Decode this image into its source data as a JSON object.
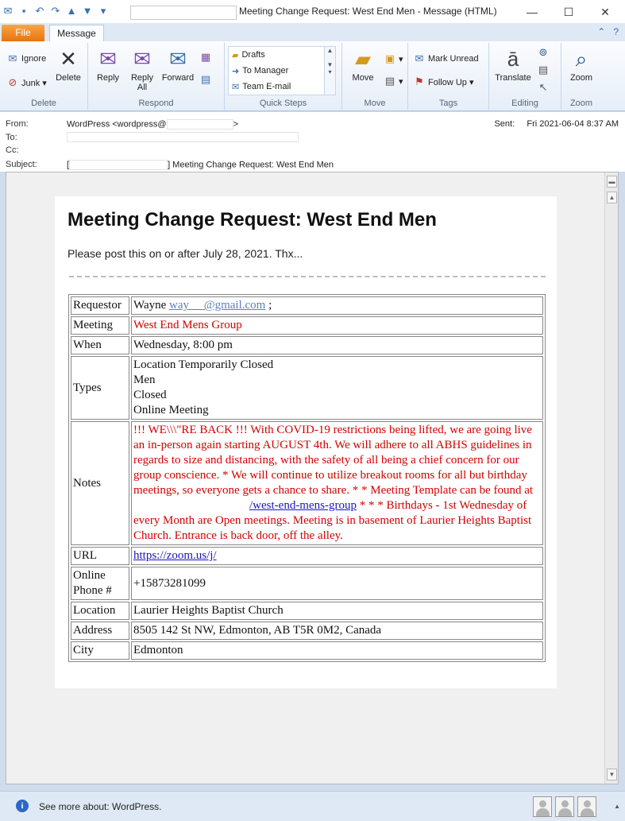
{
  "window": {
    "title": "Meeting Change Request: West End Men  -  Message (HTML)",
    "controls": {
      "minimize": "—",
      "maximize": "☐",
      "close": "✕"
    }
  },
  "qat": {
    "icons": [
      "envelope-icon",
      "save-icon",
      "undo-icon",
      "redo-icon",
      "up-arrow-icon",
      "down-arrow-icon",
      "customize-icon"
    ]
  },
  "tabs": {
    "file": "File",
    "message": "Message",
    "collapse": "⌃",
    "help": "?"
  },
  "ribbon": {
    "delete_group": {
      "label": "Delete",
      "ignore": "Ignore",
      "junk": "Junk ▾",
      "delete": "Delete"
    },
    "respond_group": {
      "label": "Respond",
      "reply": "Reply",
      "reply_all": "Reply All",
      "forward": "Forward"
    },
    "quick_steps": {
      "label": "Quick Steps",
      "items": [
        "Drafts",
        "To Manager",
        "Team E-mail"
      ]
    },
    "move_group": {
      "label": "Move",
      "move": "Move"
    },
    "tags_group": {
      "label": "Tags",
      "mark_unread": "Mark Unread",
      "follow_up": "Follow Up ▾"
    },
    "editing_group": {
      "label": "Editing",
      "translate": "Translate"
    },
    "zoom_group": {
      "label": "Zoom",
      "zoom": "Zoom"
    }
  },
  "header": {
    "from_label": "From:",
    "from_value_prefix": "WordPress <wordpress@",
    "from_value_suffix": ">",
    "to_label": "To:",
    "cc_label": "Cc:",
    "subject_label": "Subject:",
    "subject_prefix": "[",
    "subject_suffix": "] Meeting Change Request: West End Men",
    "sent_label": "Sent:",
    "sent_value": "Fri 2021-06-04 8:37 AM"
  },
  "message": {
    "heading": "Meeting Change Request: West End Men",
    "intro": "Please post this on or after July 28, 2021. Thx...",
    "rows": {
      "requestor_label": "Requestor",
      "requestor_name": "Wayne",
      "requestor_email": "way     @gmail.com",
      "requestor_trail": ";",
      "meeting_label": "Meeting",
      "meeting_value": "West End Mens Group",
      "when_label": "When",
      "when_value": "Wednesday, 8:00 pm",
      "types_label": "Types",
      "types": [
        "Location Temporarily Closed",
        "Men",
        "Closed",
        "Online Meeting"
      ],
      "notes_label": "Notes",
      "notes_part1": "!!! WE\\\\\\\"RE BACK !!! With COVID-19 restrictions being lifted, we are going live an in-person again starting AUGUST 4th. We will adhere to all ABHS guidelines in regards to size and distancing, with the safety of all being a chief concern for our group conscience. * We will continue to utilize breakout rooms for all but birthday meetings, so everyone gets a chance to share. * * Meeting Template can be found at",
      "notes_link": "/west-end-mens-group",
      "notes_part2": "* * * Birthdays - 1st Wednesday of every Month are Open meetings. Meeting is in basement of Laurier Heights Baptist Church. Entrance is back door, off the alley.",
      "url_label": "URL",
      "url_value": "https://zoom.us/j/",
      "phone_label": "Online Phone #",
      "phone_value": "+15873281099",
      "location_label": "Location",
      "location_value": "Laurier Heights Baptist Church",
      "address_label": "Address",
      "address_value": "8505 142 St NW, Edmonton, AB T5R 0M2, Canada",
      "city_label": "City",
      "city_value": "Edmonton"
    }
  },
  "statusbar": {
    "text": "See more about: WordPress.",
    "info_glyph": "i"
  },
  "colors": {
    "accent_red": "#d40000",
    "link_blue": "#1a12c7",
    "file_tab": "#e8730e"
  }
}
